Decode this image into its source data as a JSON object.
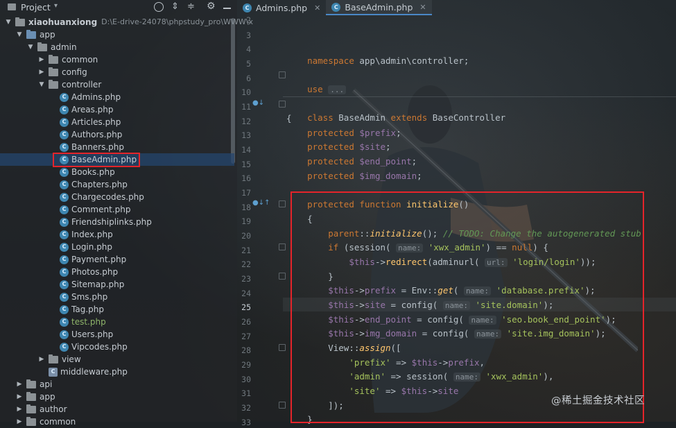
{
  "project_panel": {
    "title": "Project",
    "root": {
      "name": "xiaohuanxiong",
      "path": "D:\\E-drive-24078\\phpstudy_pro\\WWW\\x"
    },
    "items": [
      {
        "label": "app",
        "kind": "folder-blue",
        "open": true
      },
      {
        "label": "admin",
        "kind": "folder",
        "open": true
      },
      {
        "label": "common",
        "kind": "folder",
        "open": false
      },
      {
        "label": "config",
        "kind": "folder",
        "open": false
      },
      {
        "label": "controller",
        "kind": "folder",
        "open": true
      },
      {
        "label": "Admins.php",
        "kind": "php"
      },
      {
        "label": "Areas.php",
        "kind": "php"
      },
      {
        "label": "Articles.php",
        "kind": "php"
      },
      {
        "label": "Authors.php",
        "kind": "php"
      },
      {
        "label": "Banners.php",
        "kind": "php"
      },
      {
        "label": "BaseAdmin.php",
        "kind": "php",
        "selected": true
      },
      {
        "label": "Books.php",
        "kind": "php"
      },
      {
        "label": "Chapters.php",
        "kind": "php"
      },
      {
        "label": "Chargecodes.php",
        "kind": "php"
      },
      {
        "label": "Comment.php",
        "kind": "php"
      },
      {
        "label": "Friendshiplinks.php",
        "kind": "php"
      },
      {
        "label": "Index.php",
        "kind": "php"
      },
      {
        "label": "Login.php",
        "kind": "php"
      },
      {
        "label": "Payment.php",
        "kind": "php"
      },
      {
        "label": "Photos.php",
        "kind": "php"
      },
      {
        "label": "Sitemap.php",
        "kind": "php"
      },
      {
        "label": "Sms.php",
        "kind": "php"
      },
      {
        "label": "Tag.php",
        "kind": "php"
      },
      {
        "label": "test.php",
        "kind": "php",
        "color": "#8fb56a"
      },
      {
        "label": "Users.php",
        "kind": "php"
      },
      {
        "label": "Vipcodes.php",
        "kind": "php"
      },
      {
        "label": "view",
        "kind": "folder",
        "open": false
      },
      {
        "label": "middleware.php",
        "kind": "php-db"
      },
      {
        "label": "api",
        "kind": "folder",
        "open": false
      },
      {
        "label": "app",
        "kind": "folder",
        "open": false
      },
      {
        "label": "author",
        "kind": "folder",
        "open": false
      },
      {
        "label": "common",
        "kind": "folder",
        "open": false
      }
    ]
  },
  "tabs": [
    {
      "label": "Admins.php",
      "active": false
    },
    {
      "label": "BaseAdmin.php",
      "active": true
    }
  ],
  "editor": {
    "current_line": "25",
    "lines": [
      {
        "n": "2"
      },
      {
        "n": "3"
      },
      {
        "n": "4"
      },
      {
        "n": "5"
      },
      {
        "n": "6"
      },
      {
        "n": "10"
      },
      {
        "n": "11"
      },
      {
        "n": "12"
      },
      {
        "n": "13"
      },
      {
        "n": "14"
      },
      {
        "n": "15"
      },
      {
        "n": "16"
      },
      {
        "n": "17"
      },
      {
        "n": "18"
      },
      {
        "n": "19"
      },
      {
        "n": "20"
      },
      {
        "n": "21"
      },
      {
        "n": "22"
      },
      {
        "n": "23"
      },
      {
        "n": "24"
      },
      {
        "n": "25"
      },
      {
        "n": "26"
      },
      {
        "n": "27"
      },
      {
        "n": "28"
      },
      {
        "n": "29"
      },
      {
        "n": "30"
      },
      {
        "n": "31"
      },
      {
        "n": "32"
      },
      {
        "n": "33"
      }
    ],
    "code": {
      "namespace": "namespace",
      "namespace_path": "app\\admin\\controller;",
      "use": "use",
      "use_fold": "...",
      "class_kw": "class",
      "class_name": "BaseAdmin",
      "extends_kw": "extends",
      "parent_class": "BaseController",
      "brace_open": "{",
      "protected": "protected",
      "prop_prefix": "$prefix",
      "prop_site": "$site",
      "prop_end_point": "$end_point",
      "prop_img_domain": "$img_domain",
      "semicolon": ";",
      "function_kw": "function",
      "initialize": "initialize",
      "parens": "()",
      "parent": "parent",
      "dcolon": "::",
      "call_end": "();",
      "comment": "// TODO: Change the autogenerated stub",
      "if_kw": "if",
      "session_call": "(session(",
      "hint_name": "name:",
      "str_xwx_admin": "'xwx_admin'",
      "eq_null": ") ==",
      "null_kw": "null",
      "close_brace_open": ") {",
      "this": "$this",
      "arrow": "->",
      "redirect": "redirect",
      "adminurl_call": "(adminurl(",
      "hint_url": "url:",
      "str_login": "'login/login'",
      "close2": "));",
      "brace_close": "}",
      "prefix": "prefix",
      "assign": " = Env::",
      "get": "get",
      "paren_open": "(",
      "str_db_prefix": "'database.prefix'",
      "close1": ");",
      "site": "site",
      "config_call": " = config(",
      "str_site_domain": "'site.domain'",
      "end_point": "end_point",
      "str_seo": "'seo.book_end_point'",
      "img_domain": "img_domain",
      "str_img_domain": "'site.img_domain'",
      "view": "View::",
      "assign_fn": "assign",
      "arr_open": "([",
      "str_prefix": "'prefix'",
      "fat_arrow": " => ",
      "comma": ",",
      "str_admin": "'admin'",
      "session_fn": "session(",
      "close_comma": "),",
      "str_site": "'site'",
      "arr_close": "]);"
    }
  },
  "watermark": "@稀土掘金技术社区",
  "colors": {
    "selection_box": "#e5242a",
    "keyword": "#cc7832",
    "string": "#a5c25c",
    "variable": "#9876aa"
  }
}
